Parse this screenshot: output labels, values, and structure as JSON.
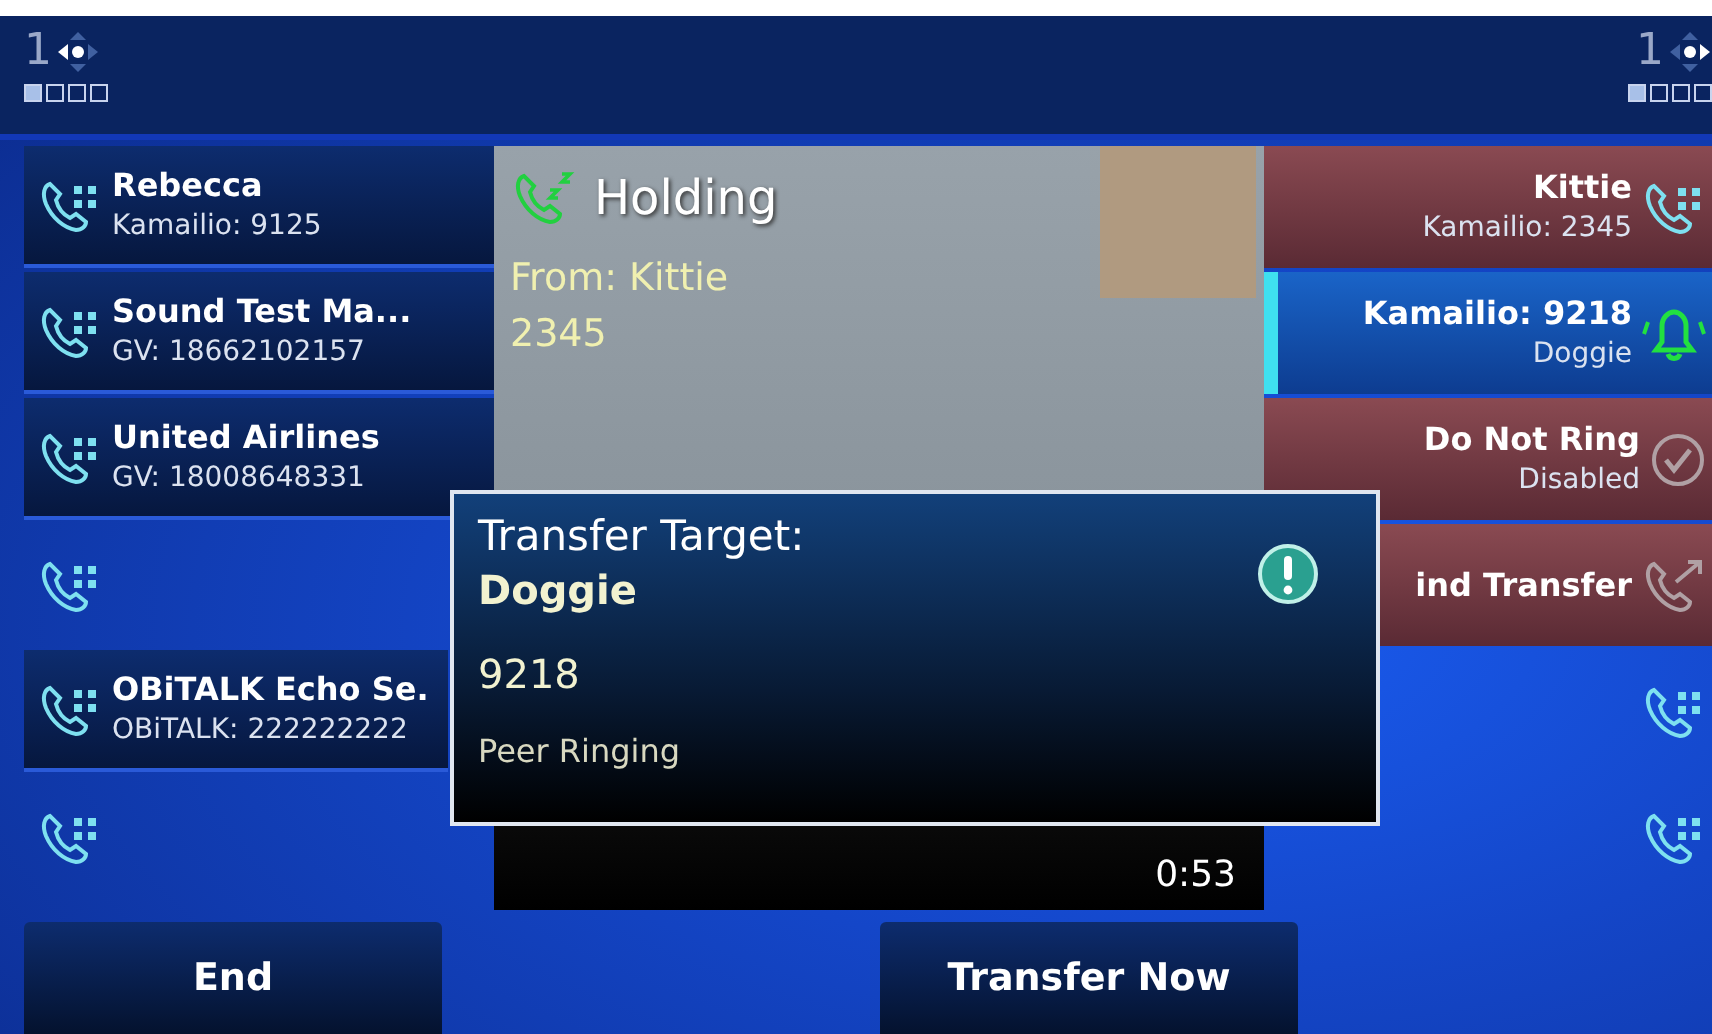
{
  "top_bar": {
    "left_page": "1",
    "right_page": "1",
    "left_dots": [
      {
        "selected": true
      },
      {
        "selected": false
      },
      {
        "selected": false
      },
      {
        "selected": false
      }
    ],
    "right_dots": [
      {
        "selected": true
      },
      {
        "selected": false
      },
      {
        "selected": false
      },
      {
        "selected": false
      }
    ]
  },
  "line_keys_left": [
    {
      "kind": "contact",
      "name": "Rebecca",
      "detail": "Kamailio: 9125"
    },
    {
      "kind": "contact",
      "name": "Sound Test Ma...",
      "detail": "GV: 18662102157"
    },
    {
      "kind": "contact",
      "name": "United Airlines",
      "detail": "GV: 18008648331"
    },
    {
      "kind": "empty"
    },
    {
      "kind": "contact",
      "name": "OBiTALK Echo Se.",
      "detail": "OBiTALK: 222222222"
    },
    {
      "kind": "empty"
    }
  ],
  "call_panel": {
    "status": "Holding",
    "from": "From: Kittie",
    "number": "2345",
    "timer": "0:53"
  },
  "line_keys_right": [
    {
      "kind": "call",
      "name": "Kittie",
      "detail": "Kamailio: 2345",
      "selected": false
    },
    {
      "kind": "ringing",
      "name": "Kamailio: 9218",
      "detail": "Doggie",
      "selected": true
    },
    {
      "kind": "toggle",
      "name": "Do Not Ring",
      "detail": "Disabled",
      "selected": false
    },
    {
      "kind": "transfer",
      "name": "ind Transfer",
      "selected": false
    },
    {
      "kind": "empty",
      "selected": false
    },
    {
      "kind": "empty",
      "selected": false
    }
  ],
  "popup": {
    "title": "Transfer Target:",
    "target": "Doggie",
    "number": "9218",
    "status": "Peer Ringing"
  },
  "soft_keys": [
    {
      "label": "End"
    },
    {
      "label": "Transfer Now"
    }
  ]
}
